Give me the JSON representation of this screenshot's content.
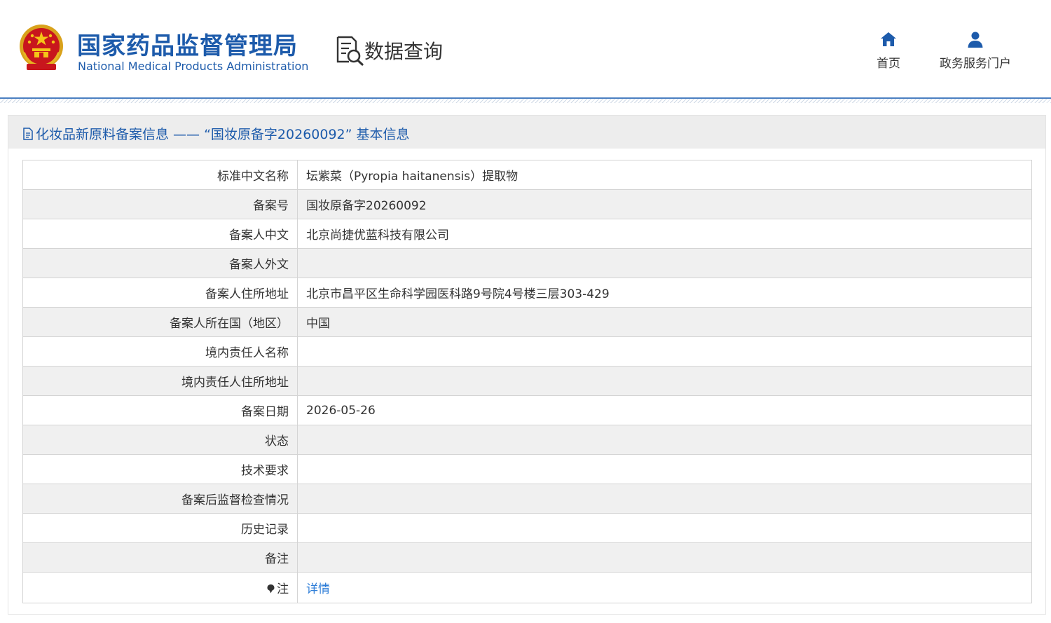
{
  "header": {
    "agency_cn": "国家药品监督管理局",
    "agency_en": "National Medical Products Administration",
    "query_label": "数据查询",
    "nav": {
      "home_label": "首页",
      "portal_label": "政务服务门户"
    }
  },
  "panel": {
    "title": "化妆品新原料备案信息 —— “国妆原备字20260092” 基本信息"
  },
  "rows": [
    {
      "label": "标准中文名称",
      "value": "坛紫菜（Pyropia haitanensis）提取物"
    },
    {
      "label": "备案号",
      "value": "国妆原备字20260092"
    },
    {
      "label": "备案人中文",
      "value": "北京尚捷优蓝科技有限公司"
    },
    {
      "label": "备案人外文",
      "value": ""
    },
    {
      "label": "备案人住所地址",
      "value": "北京市昌平区生命科学园医科路9号院4号楼三层303-429"
    },
    {
      "label": "备案人所在国（地区）",
      "value": "中国"
    },
    {
      "label": "境内责任人名称",
      "value": ""
    },
    {
      "label": "境内责任人住所地址",
      "value": ""
    },
    {
      "label": "备案日期",
      "value": "2026-05-26"
    },
    {
      "label": "状态",
      "value": ""
    },
    {
      "label": "技术要求",
      "value": ""
    },
    {
      "label": "备案后监督检查情况",
      "value": ""
    },
    {
      "label": "历史记录",
      "value": ""
    },
    {
      "label": "备注",
      "value": ""
    }
  ],
  "note_row": {
    "label": "注",
    "link_label": "详情"
  },
  "colors": {
    "brand_blue": "#1d5bab",
    "link_blue": "#2f7ed8",
    "header_rule": "#4a7fc1",
    "row_alt": "#f0f0f0"
  },
  "icons": {
    "emblem": "national-emblem-icon",
    "query": "data-query-icon",
    "home": "home-icon",
    "portal": "user-icon",
    "title": "document-icon",
    "note": "pin-icon"
  }
}
